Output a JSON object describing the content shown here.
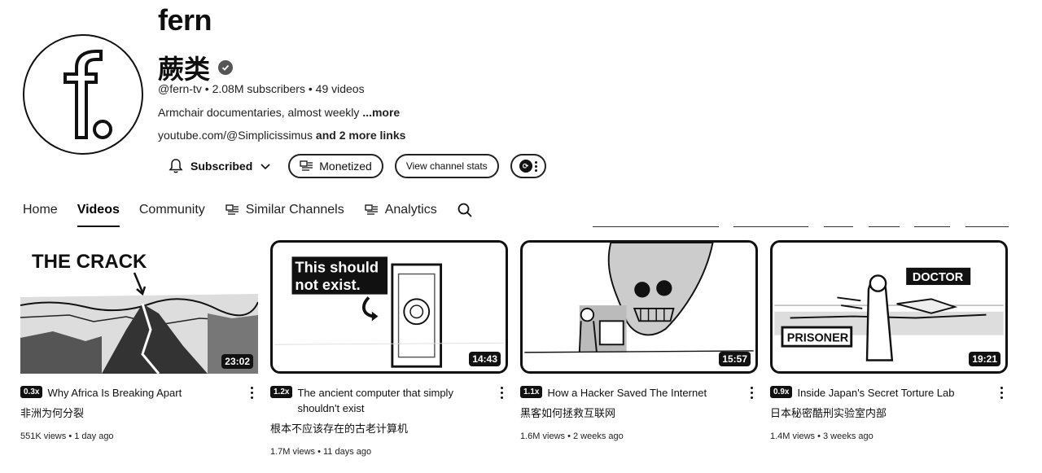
{
  "channel": {
    "name": "fern",
    "alt_name": "蕨类",
    "handle": "@fern-tv",
    "subscribers": "2.08M subscribers",
    "video_count": "49 videos",
    "description": "Armchair documentaries, almost weekly ",
    "more_label": "...more",
    "link_text": "youtube.com/@Simplicissimus",
    "more_links": " and 2 more links"
  },
  "actions": {
    "subscribed": "Subscribed",
    "monetized": "Monetized",
    "view_stats": "View channel stats"
  },
  "tabs": {
    "home": "Home",
    "videos": "Videos",
    "community": "Community",
    "similar": "Similar Channels",
    "analytics": "Analytics"
  },
  "videos": [
    {
      "speed": "0.3x",
      "title": "Why Africa Is Breaking Apart",
      "subtitle": "非洲为何分裂",
      "views": "551K views",
      "age": "1 day ago",
      "duration": "23:02",
      "thumb_text": "THE CRACK"
    },
    {
      "speed": "1.2x",
      "title": "The ancient computer that simply shouldn't exist",
      "subtitle": "根本不应该存在的古老计算机",
      "views": "1.7M views",
      "age": "11 days ago",
      "duration": "14:43",
      "thumb_text_1": "This should",
      "thumb_text_2": "not exist."
    },
    {
      "speed": "1.1x",
      "title": "How a Hacker Saved The Internet",
      "subtitle": "黑客如何拯救互联网",
      "views": "1.6M views",
      "age": "2 weeks ago",
      "duration": "15:57"
    },
    {
      "speed": "0.9x",
      "title": "Inside Japan's Secret Torture Lab",
      "subtitle": "日本秘密酷刑实验室内部",
      "views": "1.4M views",
      "age": "3 weeks ago",
      "duration": "19:21",
      "thumb_label_a": "DOCTOR",
      "thumb_label_b": "PRISONER"
    }
  ],
  "separator": " • ",
  "icons": [
    "verified-icon",
    "bell-icon",
    "chevron-down-icon",
    "monetized-icon",
    "extension-icon",
    "more-vert-icon",
    "similar-icon",
    "analytics-icon",
    "search-icon",
    "kebab-icon"
  ]
}
